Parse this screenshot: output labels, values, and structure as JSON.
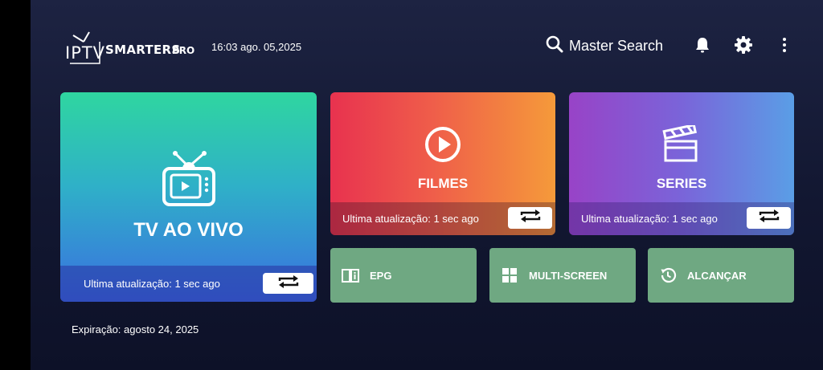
{
  "header": {
    "logo": {
      "iptv": "IPTV",
      "smarters": "SMARTERS",
      "pro": "PRO"
    },
    "datetime": "16:03  ago. 05,2025",
    "search_label": "Master Search",
    "icons": [
      "search-icon",
      "bell-icon",
      "gear-icon",
      "more-vert-icon"
    ]
  },
  "cards": {
    "live": {
      "title": "TV AO VIVO",
      "update": "Ultima atualização: 1 sec ago"
    },
    "movies": {
      "title": "FILMES",
      "update": "Ultima atualização: 1 sec ago"
    },
    "series": {
      "title": "SERIES",
      "update": "Ultima atualização: 1 sec ago"
    }
  },
  "tiles": {
    "epg": "EPG",
    "multiscreen": "MULTI-SCREEN",
    "catchup": "ALCANÇAR"
  },
  "footer": {
    "expiry": "Expiração: agosto 24, 2025"
  },
  "colors": {
    "background": "#151a35",
    "live_gradient": [
      "#2fd6a0",
      "#3a6fe0"
    ],
    "movies_gradient": [
      "#e8324f",
      "#f59a3a"
    ],
    "series_gradient": [
      "#9843c7",
      "#5a9ee6"
    ],
    "tile": "#6fa882"
  }
}
